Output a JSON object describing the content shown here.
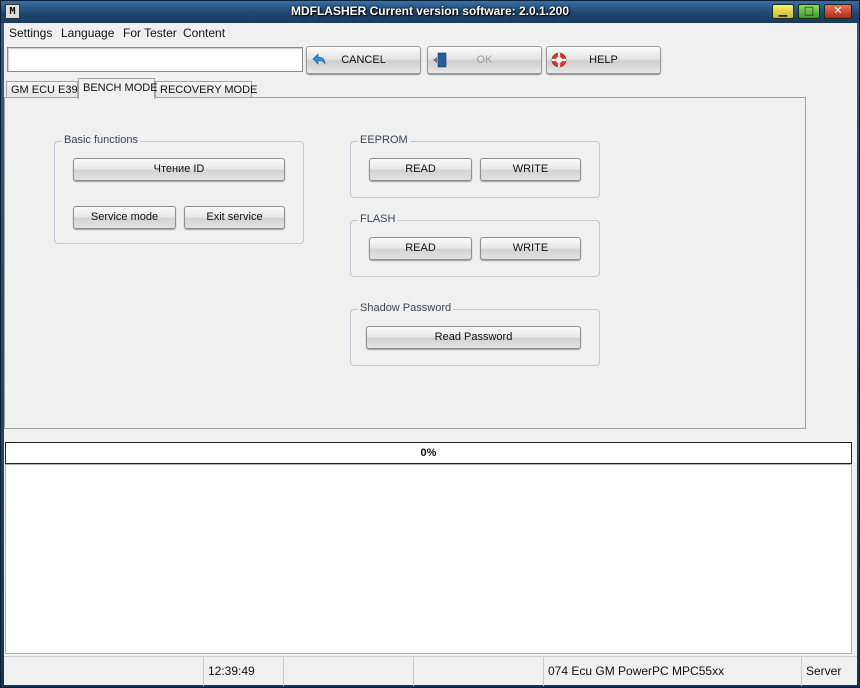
{
  "window": {
    "title": "MDFLASHER  Current version software: 2.0.1.200",
    "app_icon": "M",
    "controls": {
      "min": "▁",
      "max": "□",
      "close": "✕"
    }
  },
  "menu": {
    "items": [
      "Settings",
      "Language",
      "For Tester",
      "Content"
    ]
  },
  "toolbar": {
    "input_value": "",
    "cancel_label": "CANCEL",
    "ok_label": "OK",
    "help_label": "HELP",
    "cancel_icon": "undo-arrow-icon",
    "ok_icon": "door-exit-icon",
    "help_icon": "lifebuoy-icon"
  },
  "tabs": [
    {
      "label": "GM ECU E39",
      "active": false
    },
    {
      "label": "BENCH MODE",
      "active": true
    },
    {
      "label": "RECOVERY MODE",
      "active": false
    }
  ],
  "bench": {
    "basic": {
      "title": "Basic functions",
      "read_id": "Чтение ID",
      "service_mode": "Service mode",
      "exit_service": "Exit service"
    },
    "eeprom": {
      "title": "EEPROM",
      "read": "READ",
      "write": "WRITE"
    },
    "flash": {
      "title": "FLASH",
      "read": "READ",
      "write": "WRITE"
    },
    "shadow": {
      "title": "Shadow Password",
      "read_password": "Read Password"
    }
  },
  "progress": {
    "text": "0%",
    "value": 0
  },
  "log": {
    "content": ""
  },
  "status": {
    "cell1": "",
    "time": "12:39:49",
    "cell3": "",
    "cell4": "",
    "ecu": "074 Ecu GM PowerPC MPC55xx",
    "server": "Server"
  },
  "colors": {
    "titlebar": "#20466f",
    "progress_fill": "#4c8fd8",
    "help_icon": "#d9362b",
    "cancel_icon": "#2f8fe0",
    "ok_icon": "#1f5fa8"
  }
}
